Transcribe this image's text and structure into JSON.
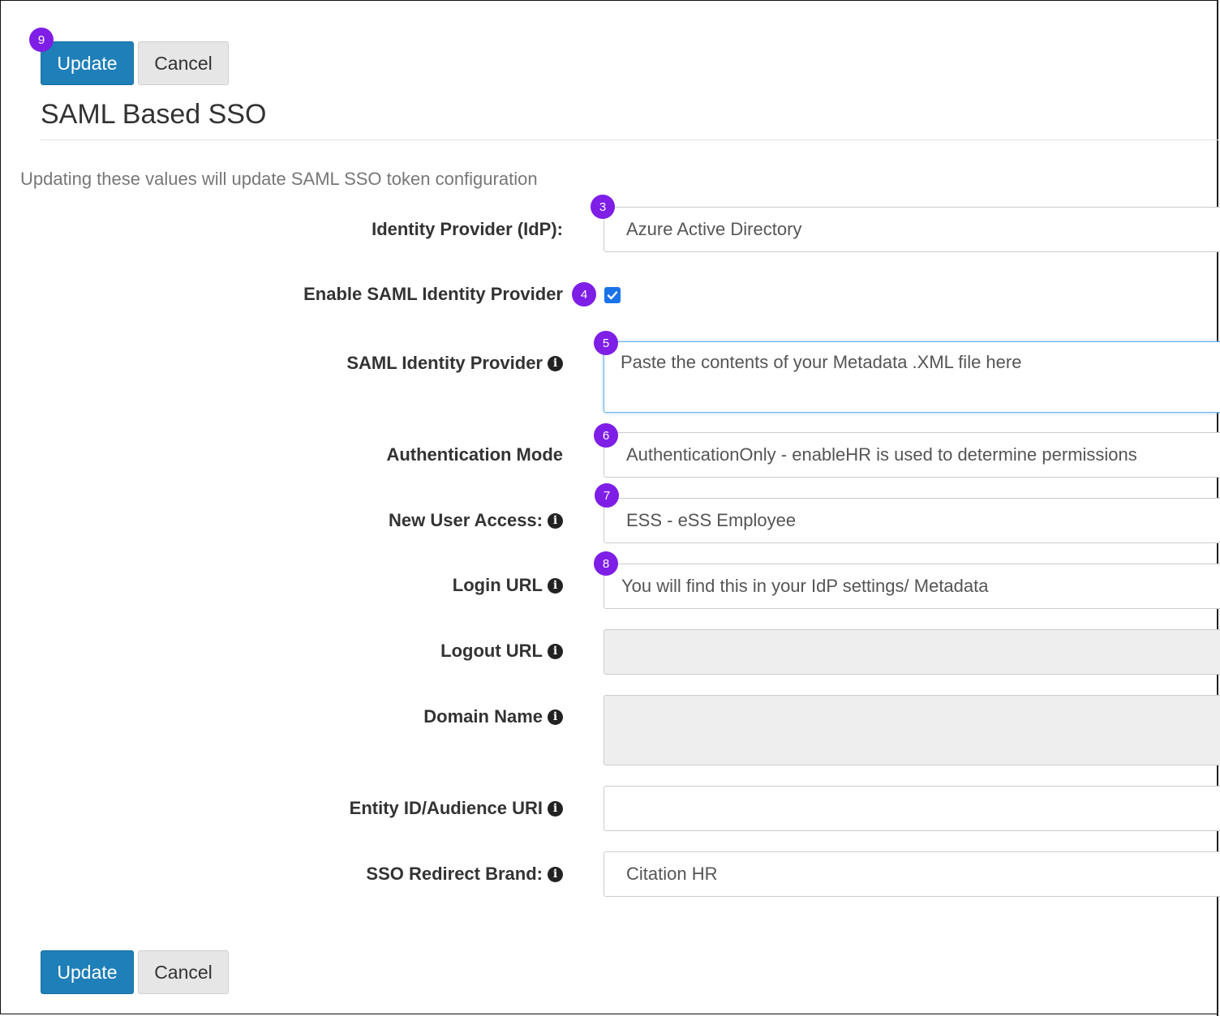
{
  "toolbar": {
    "update_label": "Update",
    "cancel_label": "Cancel"
  },
  "footer": {
    "update_label": "Update",
    "cancel_label": "Cancel"
  },
  "badges": {
    "update": "9",
    "idp": "3",
    "enable": "4",
    "saml_idp": "5",
    "auth_mode": "6",
    "new_user": "7",
    "login_url": "8"
  },
  "page": {
    "title": "SAML Based SSO",
    "subtitle": "Updating these values will update SAML SSO token configuration"
  },
  "form": {
    "idp": {
      "label": "Identity Provider (IdP):",
      "value": "Azure Active Directory"
    },
    "enable": {
      "label": "Enable SAML Identity Provider",
      "checked": true
    },
    "saml_idp": {
      "label": "SAML Identity Provider",
      "placeholder": "Paste the contents of your Metadata .XML file here"
    },
    "auth_mode": {
      "label": "Authentication Mode",
      "value": "AuthenticationOnly - enableHR is used to determine permissions"
    },
    "new_user": {
      "label": "New User Access:",
      "value": "ESS - eSS Employee"
    },
    "login_url": {
      "label": "Login URL",
      "placeholder": "You will find this in your IdP settings/ Metadata"
    },
    "logout_url": {
      "label": "Logout URL",
      "value": ""
    },
    "domain_name": {
      "label": "Domain Name",
      "value": ""
    },
    "entity_id": {
      "label": "Entity ID/Audience URI",
      "value": ""
    },
    "redirect_brand": {
      "label": "SSO Redirect Brand:",
      "value": "Citation HR"
    }
  },
  "icons": {
    "info": "info-circle-icon",
    "check": "checkmark-icon"
  },
  "colors": {
    "primary": "#1f7fb8",
    "badge": "#7e1ee6",
    "checkbox": "#1a73e8"
  }
}
